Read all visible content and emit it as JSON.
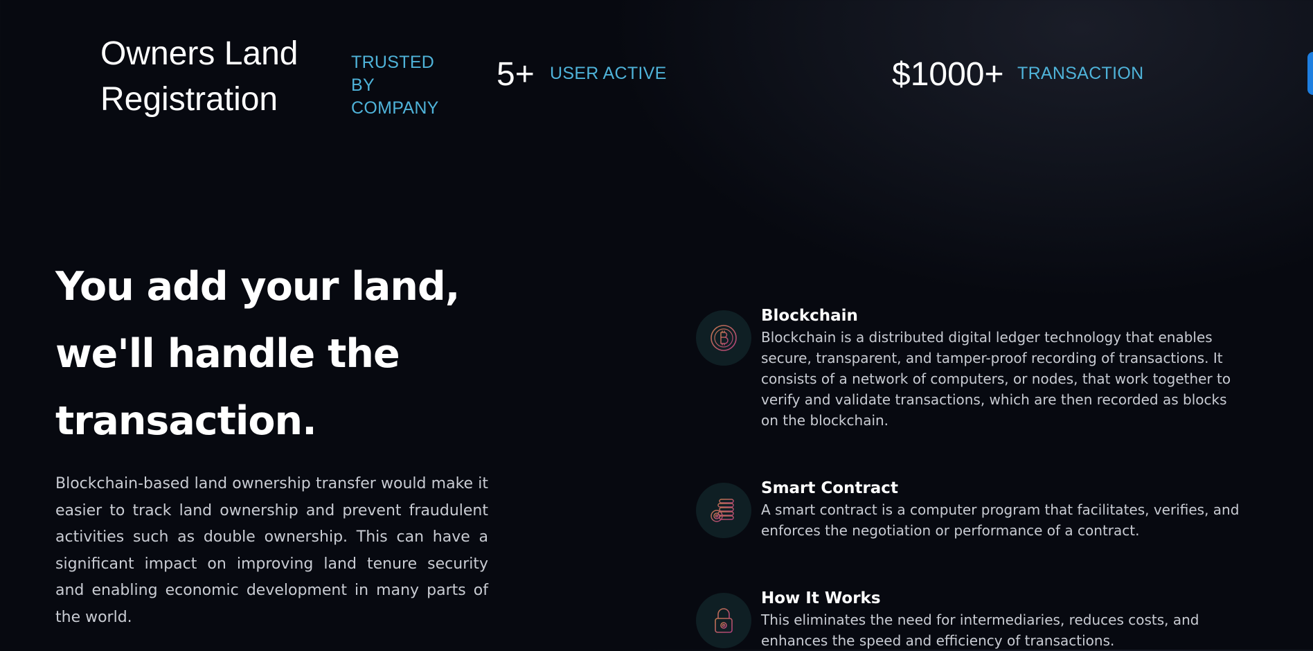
{
  "header": {
    "brand": "Owners Land Registration",
    "trusted_label": "TRUSTED BY COMPANY",
    "users_value": "5+",
    "users_label": "USER ACTIVE",
    "transaction_value": "$1000+",
    "transaction_label": "TRANSACTION"
  },
  "hero": {
    "title": "You add your land, we'll handle the transaction.",
    "description": "Blockchain-based land ownership transfer would make it easier to track land ownership and prevent fraudulent activities such as double ownership. This can have a significant impact on improving land tenure security and enabling economic development in many parts of the world."
  },
  "features": [
    {
      "icon": "bitcoin-icon",
      "title": "Blockchain",
      "text": "Blockchain is a distributed digital ledger technology that enables secure, transparent, and tamper-proof recording of transactions. It consists of a network of computers, or nodes, that work together to verify and validate transactions, which are then recorded as blocks on the blockchain."
    },
    {
      "icon": "coins-stack-icon",
      "title": "Smart Contract",
      "text": "A smart contract is a computer program that facilitates, verifies, and enforces the negotiation or performance of a contract."
    },
    {
      "icon": "lock-icon",
      "title": "How It Works",
      "text": "This eliminates the need for intermediaries, reduces costs, and enhances the speed and efficiency of transactions."
    }
  ],
  "colors": {
    "accent": "#4fb3d9",
    "icon_gradient_start": "#c2784f",
    "icon_gradient_end": "#b0407a",
    "edge_tab": "#1e7fe0"
  }
}
